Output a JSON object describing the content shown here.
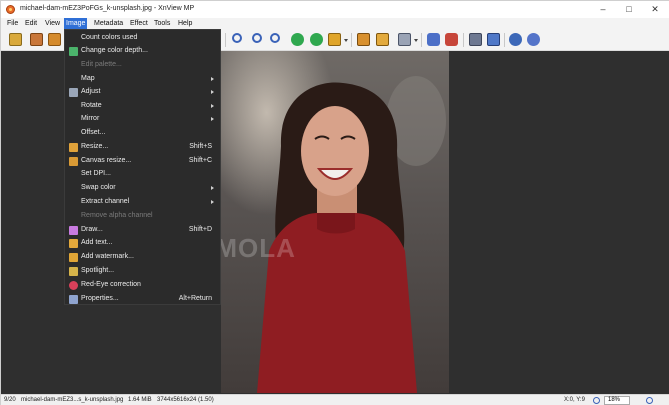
{
  "window": {
    "title": "michael-dam-mEZ3PoFGs_k-unsplash.jpg - XnView MP"
  },
  "menubar": {
    "items": [
      {
        "label": "File"
      },
      {
        "label": "Edit"
      },
      {
        "label": "View"
      },
      {
        "label": "Image",
        "active": true
      },
      {
        "label": "Metadata"
      },
      {
        "label": "Effect"
      },
      {
        "label": "Tools"
      },
      {
        "label": "Help"
      }
    ]
  },
  "toolbar": {
    "icons": [
      "tree-icon",
      "browse-icon",
      "fullscreen-icon",
      "zoom-out-icon",
      "zoom-in-icon",
      "zoom-fit-icon",
      "rotate-left-icon",
      "rotate-right-icon",
      "folder-icon",
      "crop-icon",
      "resize-icon",
      "screen-icon",
      "camera-icon",
      "paint-icon",
      "print-icon",
      "scanner-icon",
      "settings-icon",
      "help-icon"
    ]
  },
  "image_menu": {
    "items": [
      {
        "label": "Count colors used",
        "shortcut": "",
        "submenu": false,
        "disabled": false,
        "icon": ""
      },
      {
        "label": "Change color depth...",
        "shortcut": "",
        "submenu": false,
        "disabled": false,
        "icon": "color-depth-icon"
      },
      {
        "label": "Edit palette...",
        "shortcut": "",
        "submenu": false,
        "disabled": true,
        "icon": ""
      },
      {
        "label": "Map",
        "shortcut": "",
        "submenu": true,
        "disabled": false,
        "icon": ""
      },
      {
        "label": "Adjust",
        "shortcut": "",
        "submenu": true,
        "disabled": false,
        "icon": "adjust-icon"
      },
      {
        "label": "Rotate",
        "shortcut": "",
        "submenu": true,
        "disabled": false,
        "icon": ""
      },
      {
        "label": "Mirror",
        "shortcut": "",
        "submenu": true,
        "disabled": false,
        "icon": ""
      },
      {
        "label": "Offset...",
        "shortcut": "",
        "submenu": false,
        "disabled": false,
        "icon": ""
      },
      {
        "label": "Resize...",
        "shortcut": "Shift+S",
        "submenu": false,
        "disabled": false,
        "icon": "resize-icon"
      },
      {
        "label": "Canvas resize...",
        "shortcut": "Shift+C",
        "submenu": false,
        "disabled": false,
        "icon": "canvas-resize-icon"
      },
      {
        "label": "Set DPI...",
        "shortcut": "",
        "submenu": false,
        "disabled": false,
        "icon": ""
      },
      {
        "label": "Swap color",
        "shortcut": "",
        "submenu": true,
        "disabled": false,
        "icon": ""
      },
      {
        "label": "Extract channel",
        "shortcut": "",
        "submenu": true,
        "disabled": false,
        "icon": ""
      },
      {
        "label": "Remove alpha channel",
        "shortcut": "",
        "submenu": false,
        "disabled": true,
        "icon": ""
      },
      {
        "label": "Draw...",
        "shortcut": "Shift+D",
        "submenu": false,
        "disabled": false,
        "icon": "draw-icon"
      },
      {
        "label": "Add text...",
        "shortcut": "",
        "submenu": false,
        "disabled": false,
        "icon": "add-text-icon"
      },
      {
        "label": "Add watermark...",
        "shortcut": "",
        "submenu": false,
        "disabled": false,
        "icon": "watermark-icon"
      },
      {
        "label": "Spotlight...",
        "shortcut": "",
        "submenu": false,
        "disabled": false,
        "icon": "spotlight-icon"
      },
      {
        "label": "Red-Eye correction",
        "shortcut": "",
        "submenu": false,
        "disabled": false,
        "icon": "red-eye-icon"
      },
      {
        "label": "Properties...",
        "shortcut": "Alt+Return",
        "submenu": false,
        "disabled": false,
        "icon": "properties-icon"
      }
    ]
  },
  "watermark_text": "SOFTMOLA",
  "statusbar": {
    "position": "9/20",
    "filename": "michael-dam-mEZ3...s_k-unsplash.jpg",
    "filesize": "1.64 MiB",
    "dimensions": "3744x5616x24 (1.50)",
    "cursor": "X:0, Y:9",
    "zoom": "18%"
  },
  "colors": {
    "menu_bg": "#2b2b2b",
    "accent": "#2f6fd6",
    "viewer_bg": "#2f2f2f"
  }
}
